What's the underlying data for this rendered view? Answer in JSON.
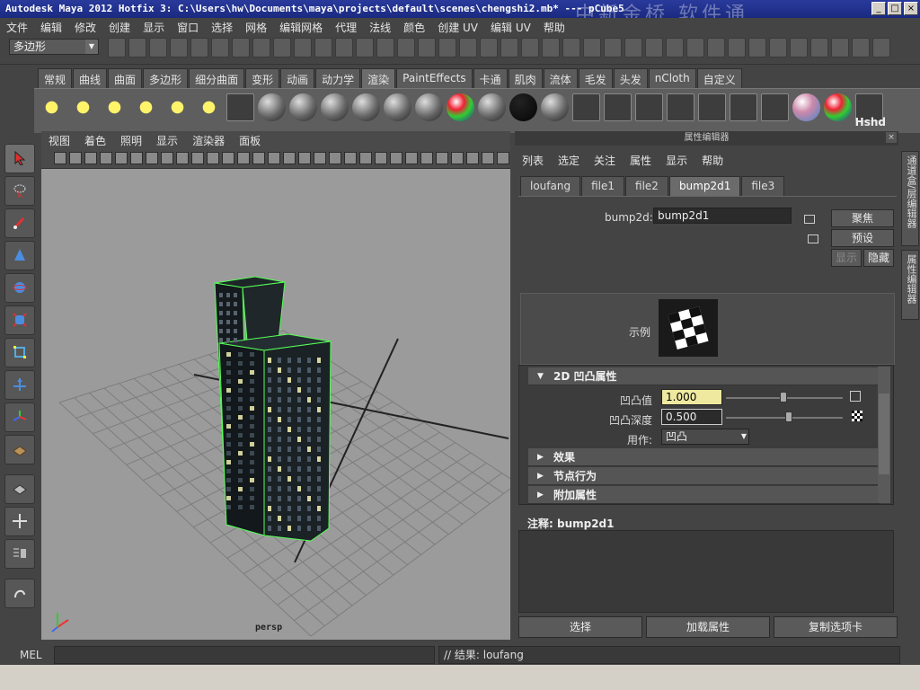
{
  "window": {
    "title": "Autodesk Maya 2012 Hotfix 3: C:\\Users\\hw\\Documents\\maya\\projects\\default\\scenes\\chengshi2.mb*   ---   pCube5",
    "watermark": "中新金桥 软件通"
  },
  "menus": [
    "文件",
    "编辑",
    "修改",
    "创建",
    "显示",
    "窗口",
    "选择",
    "网格",
    "编辑网格",
    "代理",
    "法线",
    "颜色",
    "创建 UV",
    "编辑 UV",
    "帮助"
  ],
  "status_line": {
    "mode": "多边形"
  },
  "shelf": {
    "tabs": [
      "常规",
      "曲线",
      "曲面",
      "多边形",
      "细分曲面",
      "变形",
      "动画",
      "动力学",
      "渲染",
      "PaintEffects",
      "卡通",
      "肌肉",
      "流体",
      "毛发",
      "头发",
      "nCloth",
      "自定义"
    ],
    "active_tab": "渲染",
    "last_label": "Hshd"
  },
  "viewport": {
    "menus": [
      "视图",
      "着色",
      "照明",
      "显示",
      "渲染器",
      "面板"
    ],
    "camera_label": "persp"
  },
  "attribute_editor": {
    "title": "属性编辑器",
    "menus": [
      "列表",
      "选定",
      "关注",
      "属性",
      "显示",
      "帮助"
    ],
    "tabs": [
      "loufang",
      "file1",
      "file2",
      "bump2d1",
      "file3"
    ],
    "active_tab": "bump2d1",
    "node_label": "bump2d:",
    "node_value": "bump2d1",
    "buttons": {
      "focus": "聚焦",
      "presets": "预设",
      "show": "显示",
      "hide": "隐藏"
    },
    "sample_label": "示例",
    "sections": {
      "bump_attrs": "2D 凹凸属性",
      "effects": "效果",
      "node_behavior": "节点行为",
      "extra_attrs": "附加属性"
    },
    "fields": {
      "bump_value_label": "凹凸值",
      "bump_value": "1.000",
      "bump_depth_label": "凹凸深度",
      "bump_depth": "0.500",
      "use_as_label": "用作:",
      "use_as": "凹凸"
    },
    "notes_label": "注释:  bump2d1",
    "bottom_buttons": {
      "select": "选择",
      "load_attrs": "加载属性",
      "copy_tab": "复制选项卡"
    }
  },
  "side_tabs": [
    "通道盒/层编辑器",
    "属性编辑器"
  ],
  "command_line": {
    "label": "MEL",
    "result": "// 结果: loufang"
  }
}
